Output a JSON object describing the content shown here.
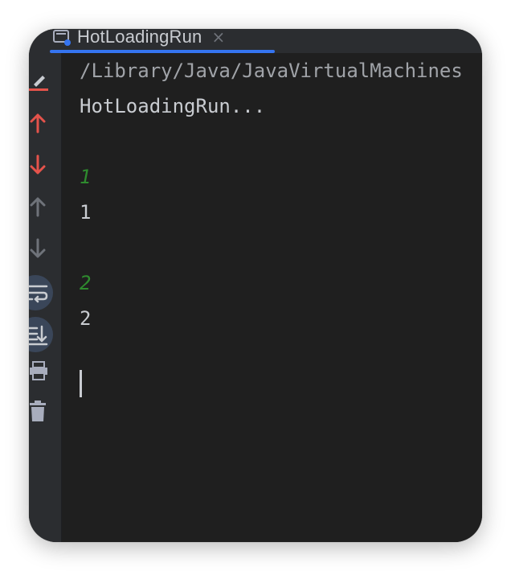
{
  "tab": {
    "title": "HotLoadingRun",
    "close_glyph": "×",
    "icon": "console-run-icon",
    "accent": "#3574f0"
  },
  "toolbar": {
    "items": [
      {
        "name": "clear-console-icon",
        "color": "#e5534b"
      },
      {
        "name": "arrow-up-red-icon",
        "color": "#e5534b"
      },
      {
        "name": "arrow-down-red-icon",
        "color": "#e5534b"
      },
      {
        "name": "arrow-up-gray-icon",
        "color": "#6f737a"
      },
      {
        "name": "arrow-down-gray-icon",
        "color": "#6f737a"
      },
      {
        "name": "soft-wrap-icon",
        "color": "#a8adbd"
      },
      {
        "name": "scroll-to-end-icon",
        "color": "#a8adbd"
      },
      {
        "name": "print-icon",
        "color": "#a8adbd"
      },
      {
        "name": "trash-icon",
        "color": "#a8adbd"
      }
    ]
  },
  "console": {
    "lines": [
      {
        "kind": "path",
        "text": "/Library/Java/JavaVirtualMachines"
      },
      {
        "kind": "output",
        "text": "HotLoadingRun..."
      },
      {
        "kind": "blank",
        "text": ""
      },
      {
        "kind": "input",
        "text": "1"
      },
      {
        "kind": "output",
        "text": "1"
      },
      {
        "kind": "blank",
        "text": ""
      },
      {
        "kind": "input",
        "text": "2"
      },
      {
        "kind": "output",
        "text": "2"
      }
    ],
    "colors": {
      "output": "#c9ccd1",
      "input": "#2e8b2e",
      "background": "#1f1f1f"
    }
  }
}
